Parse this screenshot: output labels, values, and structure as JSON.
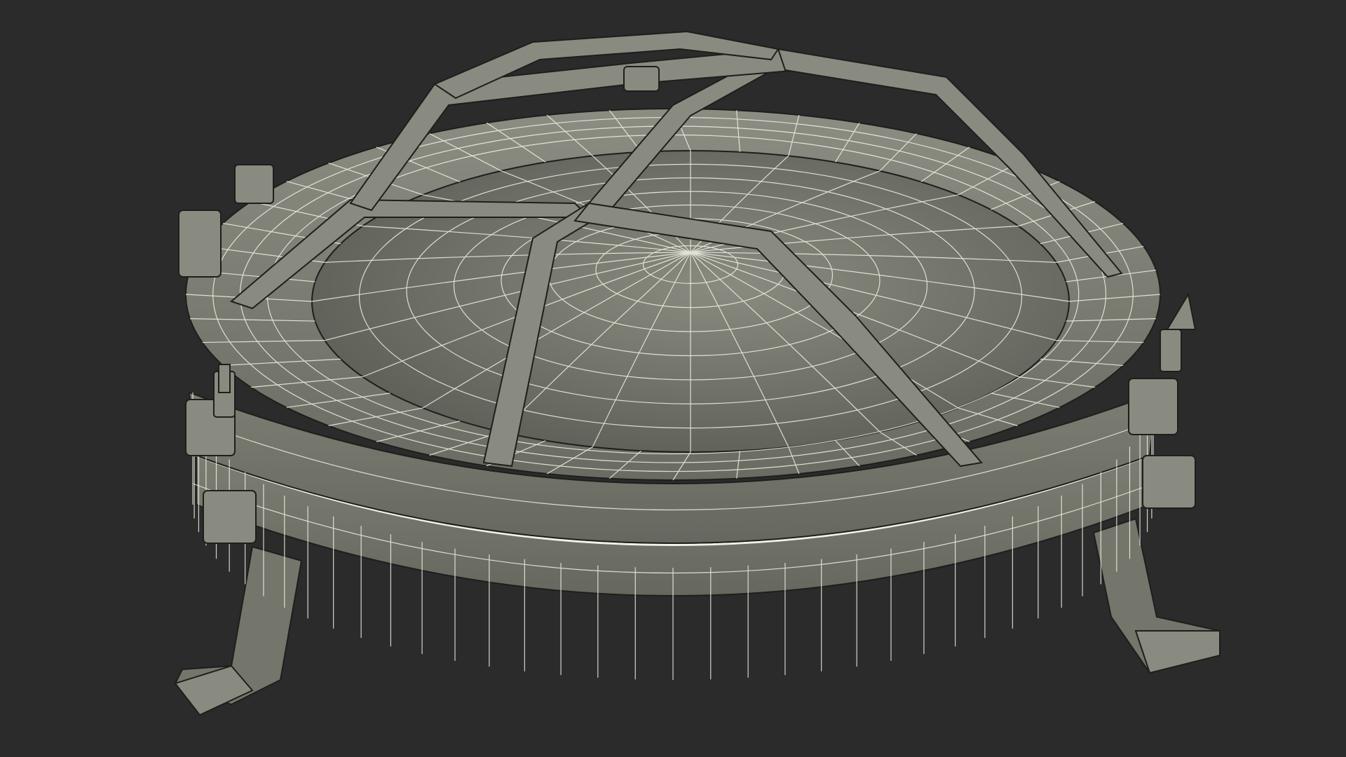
{
  "scene": {
    "subject": "wireframe-porthole-lamp",
    "colors": {
      "background": "#2b2b2b",
      "surface": "#7e7f74",
      "surface_dark": "#5f6058",
      "surface_light": "#9a9b8f",
      "wire": "#f2f2e6",
      "edge": "#1e1e1c"
    }
  }
}
